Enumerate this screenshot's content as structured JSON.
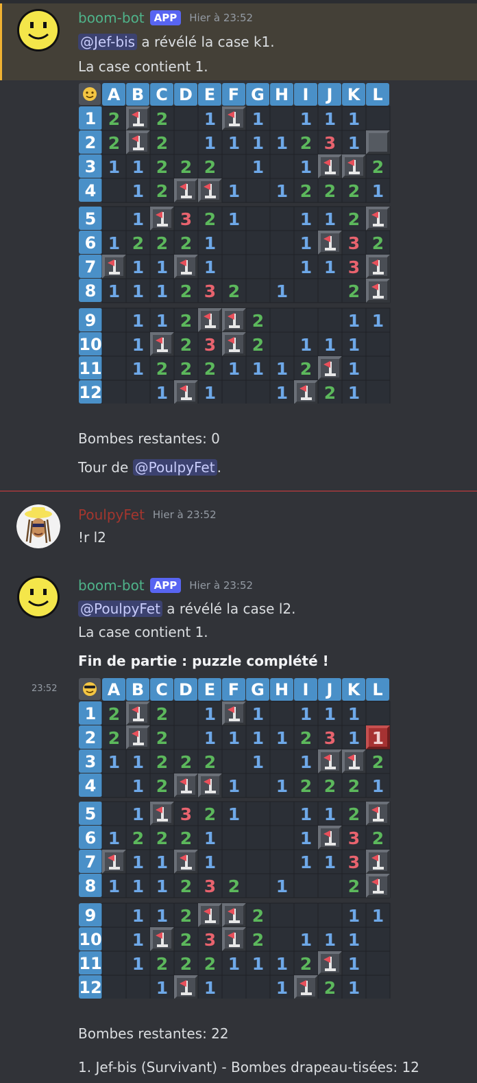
{
  "messages": [
    {
      "author": "boom-bot",
      "badge": "APP",
      "time": "Hier à 23:52",
      "mention": "@Jef-bis",
      "action": " a révélé la case k1.",
      "content_line": "La case contient 1.",
      "bombs_left": "Bombes restantes: 0",
      "turn_prefix": "Tour de ",
      "turn_mention": "@PoulpyFet",
      "turn_suffix": "."
    },
    {
      "author": "PoulpyFet",
      "time": "Hier à 23:52",
      "text": "!r l2"
    },
    {
      "author": "boom-bot",
      "badge": "APP",
      "time": "Hier à 23:52",
      "side_time": "23:52",
      "mention": "@PoulpyFet",
      "action": " a révélé la case l2.",
      "content_line": "La case contient 1.",
      "end_text": "Fin de partie : puzzle complété !",
      "bombs_left": "Bombes restantes: 22",
      "ranking": "1. Jef-bis (Survivant) - Bombes drapeau-tisées: 12"
    }
  ],
  "board": {
    "columns": [
      "A",
      "B",
      "C",
      "D",
      "E",
      "F",
      "G",
      "H",
      "I",
      "J",
      "K",
      "L"
    ],
    "rows": [
      "1",
      "2",
      "3",
      "4",
      "5",
      "6",
      "7",
      "8",
      "9",
      "10",
      "11",
      "12"
    ],
    "cells": [
      "2F2 1F1 111",
      "2F2 1111231H",
      "11222 1 1FF21",
      " 12FF1 12221",
      " 1F321  112F",
      "12221   1F32",
      "F11F1   113F",
      "111232 1  2F",
      " 112FF2   11",
      " 1F23F2 111 ",
      " 12221112F1 ",
      "  1F1  1F21 "
    ],
    "final_red_cell": "L2",
    "colors": {
      "one": "#6ea8e8",
      "two": "#5cb85c",
      "three": "#e8636e",
      "header": "#4a90c8",
      "cell": "#2b2f36",
      "hidden": "#555a61",
      "red": "#a63232"
    }
  },
  "icons": {
    "face1": "slight-smile-icon",
    "face2": "sunglasses-icon",
    "flag": "flag-icon"
  }
}
